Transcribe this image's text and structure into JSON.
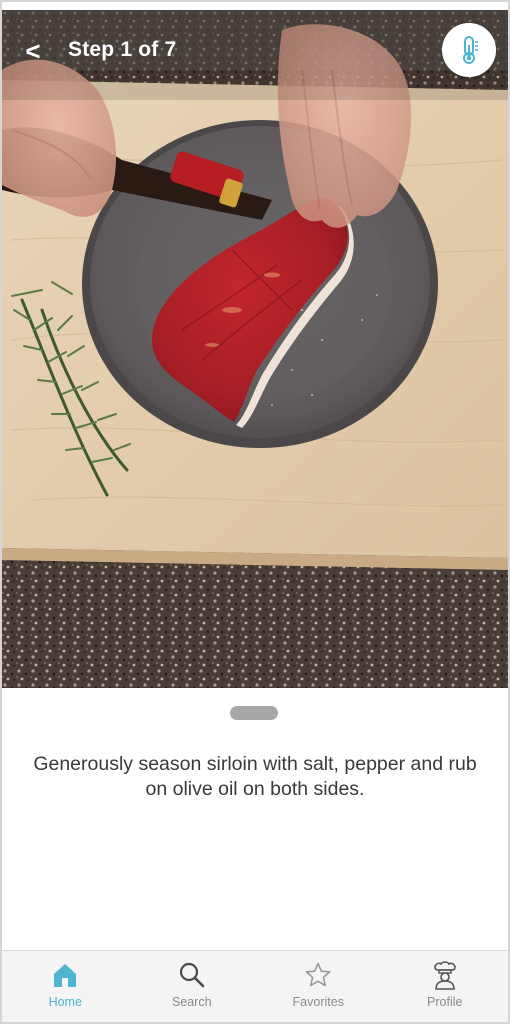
{
  "header": {
    "back_label": "<",
    "step_title": "Step 1 of 7",
    "action_icon": "thermometer-icon"
  },
  "step": {
    "instruction": "Generously season sirloin with salt, pepper and rub on olive oil on both sides."
  },
  "tabbar": {
    "items": [
      {
        "label": "Home",
        "icon": "home-icon",
        "active": true
      },
      {
        "label": "Search",
        "icon": "search-icon",
        "active": false
      },
      {
        "label": "Favorites",
        "icon": "star-icon",
        "active": false
      },
      {
        "label": "Profile",
        "icon": "chef-icon",
        "active": false
      }
    ]
  },
  "colors": {
    "accent": "#4fb5cf",
    "text": "#3a3a3a",
    "inactive": "#8b8b8b"
  }
}
